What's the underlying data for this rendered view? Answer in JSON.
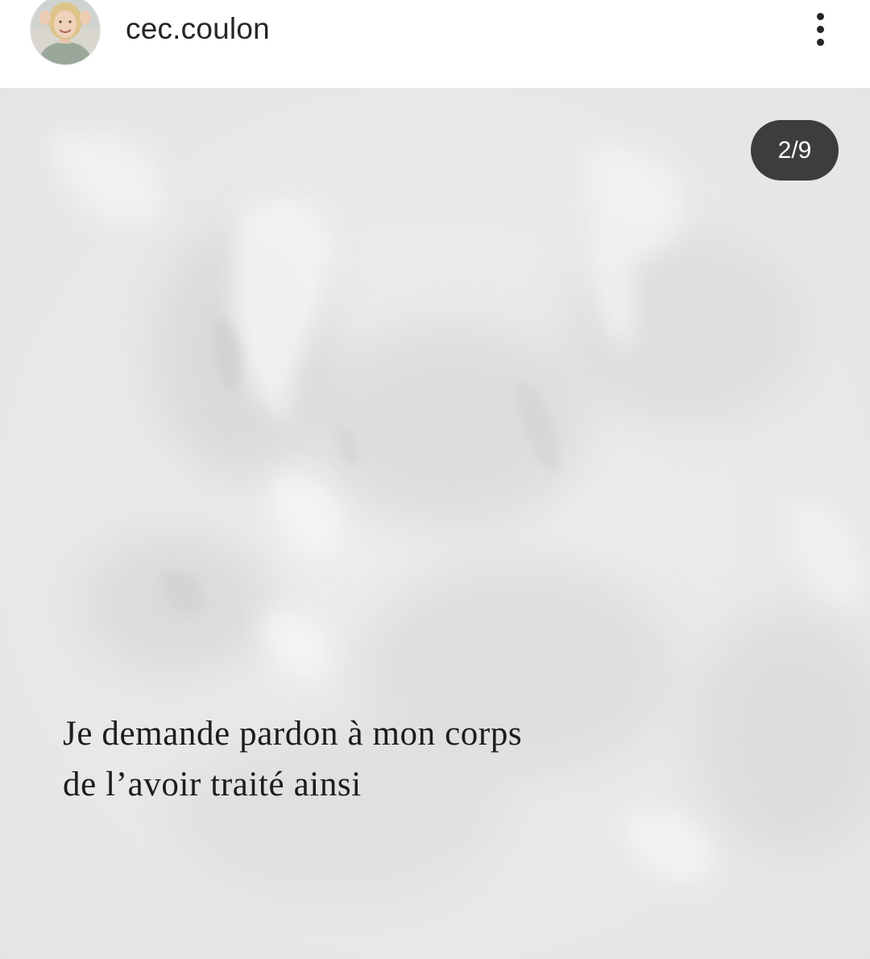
{
  "post": {
    "username": "cec.coulon",
    "avatar_icon": "profile-photo",
    "more_icon": "vertical-ellipsis-icon",
    "carousel_counter": "2/9",
    "slide_text": {
      "line1": "Je demande pardon à mon corps",
      "line2": "de l’avoir traité ainsi"
    }
  },
  "colors": {
    "background": "#ffffff",
    "paper": "#eaeaea",
    "text": "#1d1d1d",
    "counter_bg": "#262626"
  }
}
